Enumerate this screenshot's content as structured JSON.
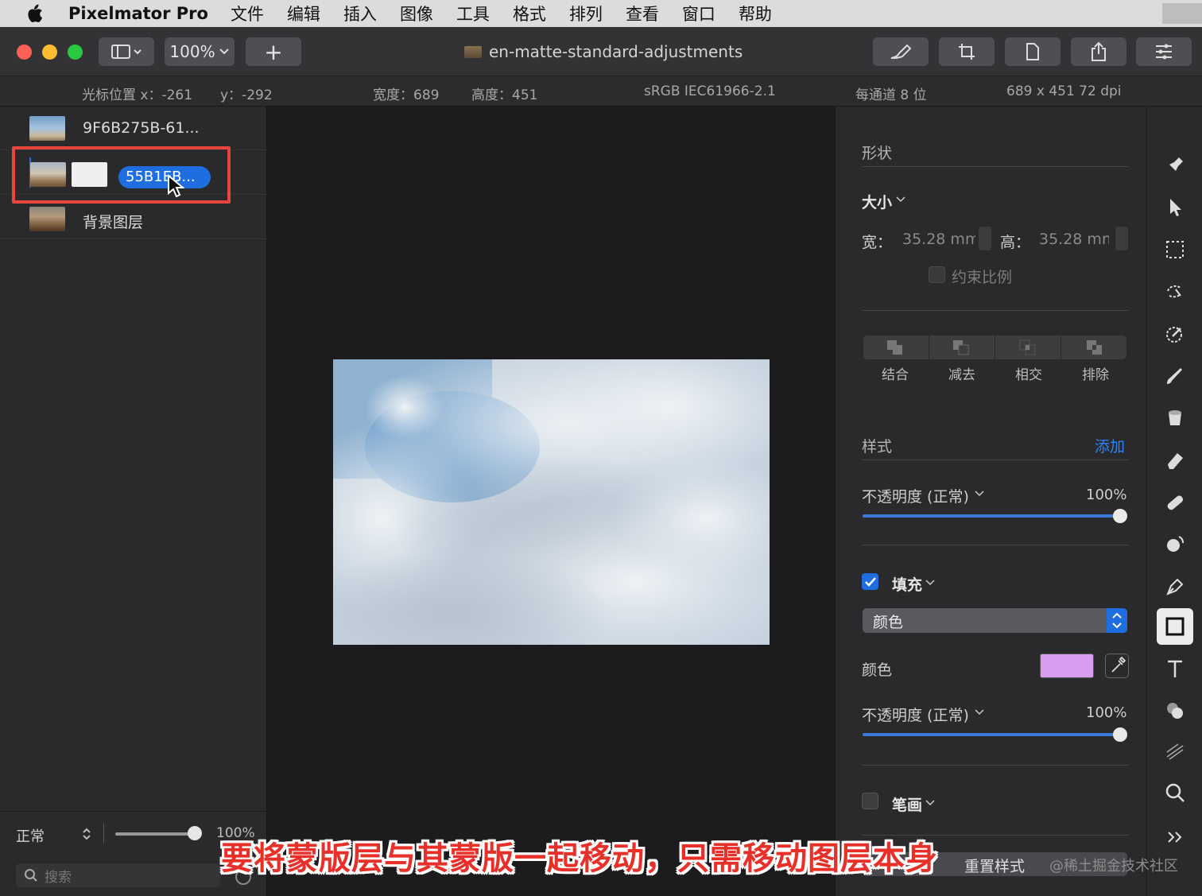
{
  "menubar": {
    "app_name": "Pixelmator Pro",
    "items": [
      "文件",
      "编辑",
      "插入",
      "图像",
      "工具",
      "格式",
      "排列",
      "查看",
      "窗口",
      "帮助"
    ]
  },
  "toolbar": {
    "zoom": "100%",
    "add_label": "+",
    "document_title": "en-matte-standard-adjustments"
  },
  "infobar": {
    "cursor_x": "光标位置 x：-261",
    "cursor_y": "y：-292",
    "width": "宽度：689",
    "height": "高度：451",
    "color_profile": "sRGB IEC61966-2.1",
    "bit_depth": "每通道 8 位",
    "size_dpi": "689 x 451 72 dpi"
  },
  "layers": {
    "items": [
      {
        "name": "9F6B275B-61..."
      },
      {
        "name": "55B1EB..."
      },
      {
        "name": "背景图层"
      }
    ],
    "blend_mode": "正常",
    "opacity": "100%",
    "opacity_value": 1.0,
    "search_placeholder": "搜索"
  },
  "inspector": {
    "shape_header": "形状",
    "size_label": "大小",
    "width_label": "宽：",
    "width_value": "35.28 mm",
    "height_label": "高：",
    "height_value": "35.28 mm",
    "constrain_label": "约束比例",
    "combine_ops": [
      "结合",
      "减去",
      "相交",
      "排除"
    ],
    "style_header": "样式",
    "add_label": "添加",
    "opacity_label": "不透明度 (正常)",
    "opacity_value": "100%",
    "fill_label": "填充",
    "fill_type": "颜色",
    "color_label": "颜色",
    "fill_color": "#d89cf0",
    "fill_opacity_label": "不透明度 (正常)",
    "fill_opacity_value": "100%",
    "stroke_label": "笔画",
    "reset_label": "重置样式"
  },
  "subtitle": "要将蒙版层与其蒙版一起移动，只需移动图层本身",
  "watermark": "@稀土掘金技术社区",
  "colors": {
    "accent": "#1f6ee0",
    "highlight": "#e8453c"
  }
}
